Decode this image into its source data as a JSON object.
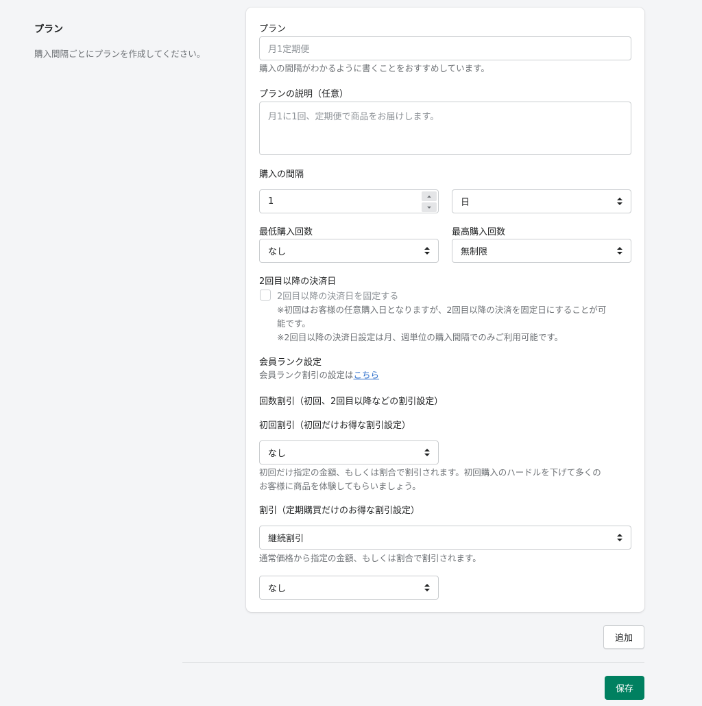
{
  "side": {
    "title": "プラン",
    "description": "購入間隔ごとにプランを作成してください。"
  },
  "form": {
    "plan_label": "プラン",
    "plan_placeholder": "月1定期便",
    "plan_help": "購入の間隔がわかるように書くことをおすすめしています。",
    "desc_label": "プランの説明（任意）",
    "desc_placeholder": "月1に1回、定期便で商品をお届けします。",
    "interval_label": "購入の間隔",
    "interval_value": "1",
    "interval_unit": "日",
    "min_label": "最低購入回数",
    "min_value": "なし",
    "max_label": "最高購入回数",
    "max_value": "無制限",
    "payment_label": "2回目以降の決済日",
    "payment_checkbox_label": "2回目以降の決済日を固定する",
    "payment_note1_line1": "※初回はお客様の任意購入日となりますが、2回目以降の決済を固定日にすることが可",
    "payment_note1_line2": "能です。",
    "payment_note2": "※2回目以降の決済日設定は月、週単位の購入間隔でのみご利用可能です。",
    "rank_label": "会員ランク設定",
    "rank_text": "会員ランク割引の設定は",
    "rank_link": "こちら",
    "count_discount_label": "回数割引（初回、2回目以降などの割引設定）",
    "first_discount_label": "初回割引（初回だけお得な割引設定）",
    "first_discount_value": "なし",
    "first_help_line1": "初回だけ指定の金額、もしくは割合で割引されます。初回購入のハードルを下げて多くの",
    "first_help_line2": "お客様に商品を体験してもらいましょう。",
    "sub_discount_label": "割引（定期購買だけのお得な割引設定）",
    "sub_discount_type": "継続割引",
    "sub_help": "通常価格から指定の金額、もしくは割合で割引されます。",
    "sub_discount_value": "なし"
  },
  "buttons": {
    "add": "追加",
    "save": "保存"
  },
  "colors": {
    "primary": "#008060",
    "link": "#2c6ecb"
  }
}
